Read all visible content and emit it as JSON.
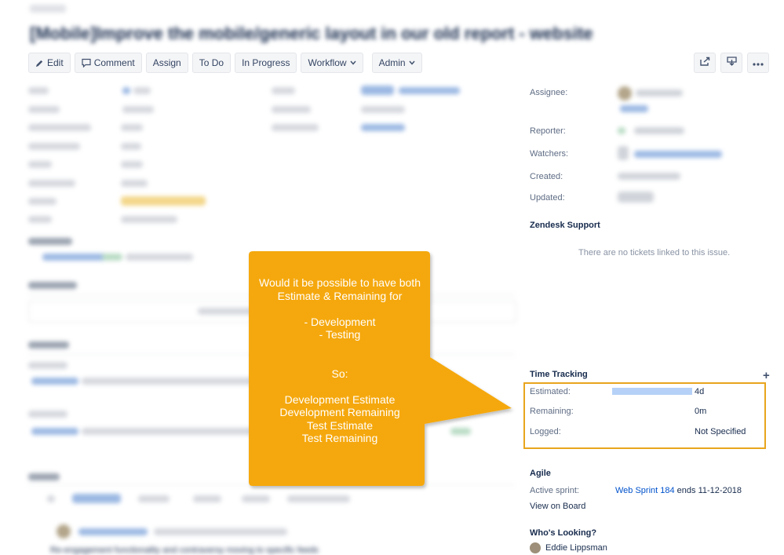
{
  "toolbar": {
    "edit": "Edit",
    "comment": "Comment",
    "assign": "Assign",
    "todo": "To Do",
    "in_progress": "In Progress",
    "workflow": "Workflow",
    "admin": "Admin"
  },
  "header": {
    "title": "[Mobile]Improve the mobile/generic layout in our old report - website"
  },
  "people": {
    "assignee_label": "Assignee:",
    "reporter_label": "Reporter:",
    "watchers_label": "Watchers:",
    "created_label": "Created:",
    "updated_label": "Updated:"
  },
  "zendesk": {
    "heading": "Zendesk Support",
    "empty": "There are no tickets linked to this issue."
  },
  "time_tracking": {
    "heading": "Time Tracking",
    "add": "+",
    "estimated_label": "Estimated:",
    "estimated_value": "4d",
    "estimated_fill": 1.0,
    "remaining_label": "Remaining:",
    "remaining_value": "0m",
    "logged_label": "Logged:",
    "logged_value": "Not Specified"
  },
  "agile": {
    "heading": "Agile",
    "active_sprint_label": "Active sprint:",
    "sprint_name": "Web Sprint 184",
    "sprint_suffix": " ends 11-12-2018",
    "view_on_board": "View on Board"
  },
  "whos_looking": {
    "heading": "Who's Looking?",
    "name": "Eddie Lippsman"
  },
  "callout": {
    "text": "Would it be possible to have both Estimate & Remaining for\n\n- Development\n- Testing\n\n\nSo:\n\nDevelopment Estimate\nDevelopment Remaining\nTest Estimate\nTest Remaining",
    "color": "#f5a80b"
  },
  "bottom": {
    "text": "Re-engagement functionality and contraversy moving to specific feeds"
  },
  "colors": {
    "highlight_border": "#e8a51e",
    "link": "#0052cc"
  }
}
